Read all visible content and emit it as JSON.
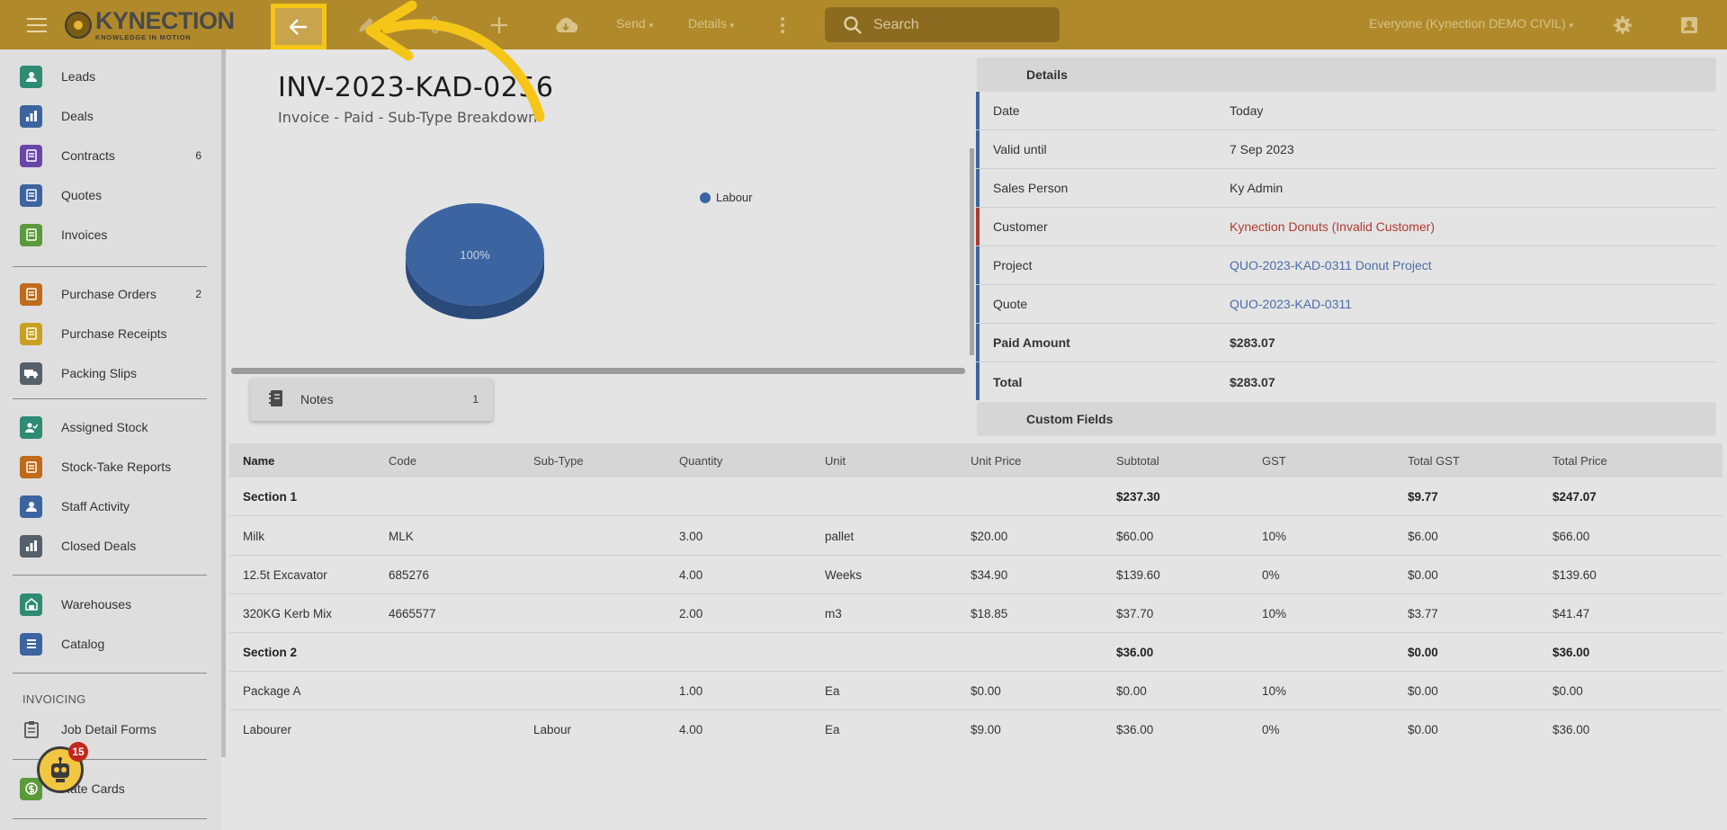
{
  "topbar": {
    "logo_text": "KYNECTION",
    "logo_tagline": "KNOWLEDGE IN MOTION",
    "menu_send": "Send",
    "menu_details": "Details",
    "search_placeholder": "Search",
    "org_selector": "Everyone (Kynection DEMO CIVIL)"
  },
  "sidebar": {
    "items": [
      {
        "label": "Leads",
        "badge": "",
        "color": "#2e8b74"
      },
      {
        "label": "Deals",
        "badge": "",
        "color": "#3c64a0"
      },
      {
        "label": "Contracts",
        "badge": "6",
        "color": "#6a45a8"
      },
      {
        "label": "Quotes",
        "badge": "",
        "color": "#3c64a0"
      },
      {
        "label": "Invoices",
        "badge": "",
        "color": "#5a9a3a"
      },
      {
        "label": "Purchase Orders",
        "badge": "2",
        "color": "#c06a1a"
      },
      {
        "label": "Purchase Receipts",
        "badge": "",
        "color": "#c9a020"
      },
      {
        "label": "Packing Slips",
        "badge": "",
        "color": "#55606a"
      },
      {
        "label": "Assigned Stock",
        "badge": "",
        "color": "#2e8b74"
      },
      {
        "label": "Stock-Take Reports",
        "badge": "",
        "color": "#c06a1a"
      },
      {
        "label": "Staff Activity",
        "badge": "",
        "color": "#3c64a0"
      },
      {
        "label": "Closed Deals",
        "badge": "",
        "color": "#55606a"
      },
      {
        "label": "Warehouses",
        "badge": "",
        "color": "#2e8b74"
      },
      {
        "label": "Catalog",
        "badge": "",
        "color": "#3c64a0"
      },
      {
        "label": "Job Detail Forms",
        "badge": "",
        "color": "#666666"
      },
      {
        "label": "Rate Cards",
        "badge": "",
        "color": "#5a9a3a"
      }
    ],
    "section_invoicing": "INVOICING",
    "assistant_badge": "15"
  },
  "main": {
    "invoice_number": "INV-2023-KAD-0256",
    "subtitle": "Invoice - Paid - Sub-Type Breakdown",
    "notes_label": "Notes",
    "notes_count": "1"
  },
  "chart_data": {
    "type": "pie",
    "title": "",
    "slices": [
      {
        "label": "Labour",
        "value": 100,
        "display": "100%",
        "color": "#3c64a0"
      }
    ],
    "legend_position": "top-right"
  },
  "details": {
    "header": "Details",
    "rows": [
      {
        "key": "Date",
        "value": "Today"
      },
      {
        "key": "Valid until",
        "value": "7 Sep 2023"
      },
      {
        "key": "Sales Person",
        "value": "Ky Admin"
      },
      {
        "key": "Customer",
        "value": "Kynection Donuts (Invalid Customer)"
      },
      {
        "key": "Project",
        "value": "QUO-2023-KAD-0311 Donut Project"
      },
      {
        "key": "Quote",
        "value": "QUO-2023-KAD-0311"
      },
      {
        "key": "Paid Amount",
        "value": "$283.07"
      },
      {
        "key": "Total",
        "value": "$283.07"
      }
    ],
    "custom_fields_header": "Custom Fields"
  },
  "table": {
    "headers": [
      "Name",
      "Code",
      "Sub-Type",
      "Quantity",
      "Unit",
      "Unit Price",
      "Subtotal",
      "GST",
      "Total GST",
      "Total Price"
    ],
    "rows": [
      [
        "Section 1",
        "",
        "",
        "",
        "",
        "",
        "$237.30",
        "",
        "$9.77",
        "$247.07"
      ],
      [
        "Milk",
        "MLK",
        "",
        "3.00",
        "pallet",
        "$20.00",
        "$60.00",
        "10%",
        "$6.00",
        "$66.00"
      ],
      [
        "12.5t Excavator",
        "685276",
        "",
        "4.00",
        "Weeks",
        "$34.90",
        "$139.60",
        "0%",
        "$0.00",
        "$139.60"
      ],
      [
        "320KG Kerb Mix",
        "4665577",
        "",
        "2.00",
        "m3",
        "$18.85",
        "$37.70",
        "10%",
        "$3.77",
        "$41.47"
      ],
      [
        "Section 2",
        "",
        "",
        "",
        "",
        "",
        "$36.00",
        "",
        "$0.00",
        "$36.00"
      ],
      [
        "Package A",
        "",
        "",
        "1.00",
        "Ea",
        "$0.00",
        "$0.00",
        "10%",
        "$0.00",
        "$0.00"
      ],
      [
        "Labourer",
        "",
        "Labour",
        "4.00",
        "Ea",
        "$9.00",
        "$36.00",
        "0%",
        "$0.00",
        "$36.00"
      ]
    ]
  }
}
